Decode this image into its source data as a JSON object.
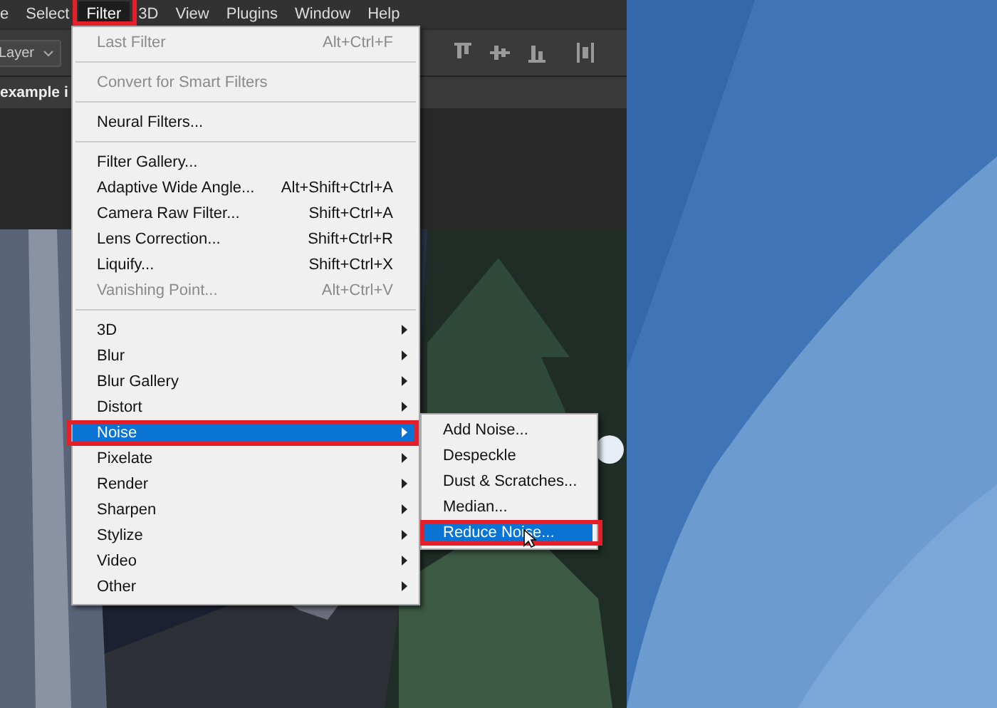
{
  "menu_bar": [
    {
      "label": "e",
      "selected": false
    },
    {
      "label": "Select",
      "selected": false
    },
    {
      "label": "Filter",
      "selected": true
    },
    {
      "label": "3D",
      "selected": false
    },
    {
      "label": "View",
      "selected": false
    },
    {
      "label": "Plugins",
      "selected": false
    },
    {
      "label": "Window",
      "selected": false
    },
    {
      "label": "Help",
      "selected": false
    }
  ],
  "options_bar": {
    "dropdown": "Layer"
  },
  "document_tab": {
    "title": "example i"
  },
  "filter_menu": [
    {
      "kind": "item",
      "label": "Last Filter",
      "shortcut": "Alt+Ctrl+F",
      "disabled": true,
      "submenu": false,
      "selected": false
    },
    {
      "kind": "separator"
    },
    {
      "kind": "item",
      "label": "Convert for Smart Filters",
      "disabled": true,
      "submenu": false,
      "selected": false
    },
    {
      "kind": "separator"
    },
    {
      "kind": "item",
      "label": "Neural Filters...",
      "disabled": false,
      "submenu": false,
      "selected": false
    },
    {
      "kind": "separator"
    },
    {
      "kind": "item",
      "label": "Filter Gallery...",
      "disabled": false,
      "submenu": false,
      "selected": false
    },
    {
      "kind": "item",
      "label": "Adaptive Wide Angle...",
      "shortcut": "Alt+Shift+Ctrl+A",
      "disabled": false,
      "submenu": false,
      "selected": false
    },
    {
      "kind": "item",
      "label": "Camera Raw Filter...",
      "shortcut": "Shift+Ctrl+A",
      "disabled": false,
      "submenu": false,
      "selected": false
    },
    {
      "kind": "item",
      "label": "Lens Correction...",
      "shortcut": "Shift+Ctrl+R",
      "disabled": false,
      "submenu": false,
      "selected": false
    },
    {
      "kind": "item",
      "label": "Liquify...",
      "shortcut": "Shift+Ctrl+X",
      "disabled": false,
      "submenu": false,
      "selected": false
    },
    {
      "kind": "item",
      "label": "Vanishing Point...",
      "shortcut": "Alt+Ctrl+V",
      "disabled": true,
      "submenu": false,
      "selected": false
    },
    {
      "kind": "separator"
    },
    {
      "kind": "item",
      "label": "3D",
      "disabled": false,
      "submenu": true,
      "selected": false
    },
    {
      "kind": "item",
      "label": "Blur",
      "disabled": false,
      "submenu": true,
      "selected": false
    },
    {
      "kind": "item",
      "label": "Blur Gallery",
      "disabled": false,
      "submenu": true,
      "selected": false
    },
    {
      "kind": "item",
      "label": "Distort",
      "disabled": false,
      "submenu": true,
      "selected": false
    },
    {
      "kind": "item",
      "label": "Noise",
      "disabled": false,
      "submenu": true,
      "selected": true
    },
    {
      "kind": "item",
      "label": "Pixelate",
      "disabled": false,
      "submenu": true,
      "selected": false
    },
    {
      "kind": "item",
      "label": "Render",
      "disabled": false,
      "submenu": true,
      "selected": false
    },
    {
      "kind": "item",
      "label": "Sharpen",
      "disabled": false,
      "submenu": true,
      "selected": false
    },
    {
      "kind": "item",
      "label": "Stylize",
      "disabled": false,
      "submenu": true,
      "selected": false
    },
    {
      "kind": "item",
      "label": "Video",
      "disabled": false,
      "submenu": true,
      "selected": false
    },
    {
      "kind": "item",
      "label": "Other",
      "disabled": false,
      "submenu": true,
      "selected": false
    }
  ],
  "noise_submenu": [
    {
      "label": "Add Noise...",
      "selected": false
    },
    {
      "label": "Despeckle",
      "selected": false
    },
    {
      "label": "Dust & Scratches...",
      "selected": false
    },
    {
      "label": "Median...",
      "selected": false
    },
    {
      "label": "Reduce Noise...",
      "selected": true
    }
  ]
}
